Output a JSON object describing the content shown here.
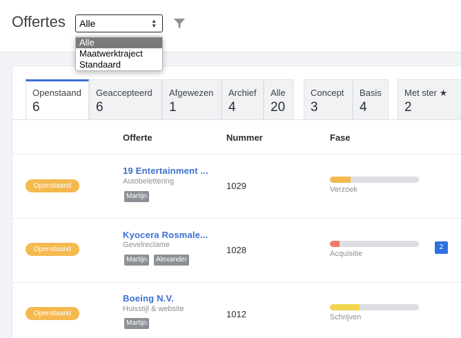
{
  "header": {
    "title": "Offertes",
    "filter_select": "Alle",
    "dropdown_options": [
      "Alle",
      "Maatwerktraject",
      "Standaard"
    ]
  },
  "tabs": [
    {
      "label": "Openstaand",
      "count": "6"
    },
    {
      "label": "Geaccepteerd",
      "count": "6"
    },
    {
      "label": "Afgewezen",
      "count": "1"
    },
    {
      "label": "Archief",
      "count": "4"
    },
    {
      "label": "Alle",
      "count": "20"
    },
    {
      "label": "Concept",
      "count": "3"
    },
    {
      "label": "Basis",
      "count": "4"
    },
    {
      "label": "Met ster ★",
      "count": "2"
    }
  ],
  "table": {
    "headers": [
      "Offerte",
      "Nummer",
      "Fase"
    ],
    "rows": [
      {
        "status": "Openstaand",
        "name": "19 Entertainment ...",
        "subtitle": "Autobelettering",
        "tags": [
          "Martijn"
        ],
        "number": "1029",
        "phase": "Verzoek",
        "progress": 0.23,
        "phase_color": "#f5b94e",
        "count": ""
      },
      {
        "status": "Openstaand",
        "name": "Kyocera Rosmale...",
        "subtitle": "Gevelreclame",
        "tags": [
          "Martijn",
          "Alexander"
        ],
        "number": "1028",
        "phase": "Acquisitie",
        "progress": 0.11,
        "phase_color": "#f07a68",
        "count": "2"
      },
      {
        "status": "Openstaand",
        "name": "Boeing N.V.",
        "subtitle": "Huisstijl & website",
        "tags": [
          "Martijn"
        ],
        "number": "1012",
        "phase": "Schrijven",
        "progress": 0.33,
        "phase_color": "#f2d54e",
        "count": ""
      }
    ]
  }
}
